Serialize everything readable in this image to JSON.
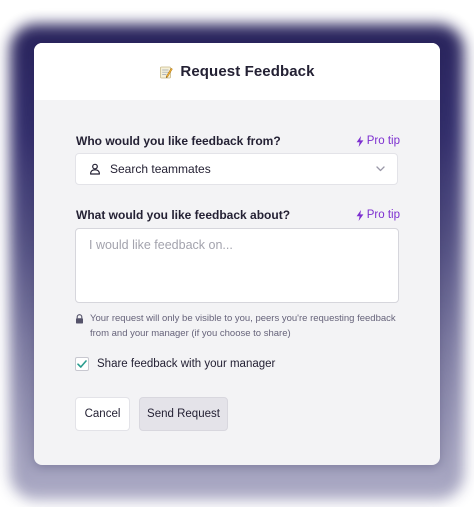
{
  "dialog": {
    "title": "Request Feedback",
    "title_icon": "memo-icon"
  },
  "recipient": {
    "label": "Who would you like feedback from?",
    "protip": "Pro tip",
    "placeholder": "Search teammates",
    "icon": "person-icon"
  },
  "topic": {
    "label": "What would you like feedback about?",
    "protip": "Pro tip",
    "placeholder": "I would like feedback on..."
  },
  "privacy": {
    "icon": "lock-icon",
    "text": "Your request will only be visible to you, peers you're requesting feedback from and your manager (if you choose to share)"
  },
  "share": {
    "label": "Share feedback with your manager",
    "checked": true
  },
  "actions": {
    "cancel_label": "Cancel",
    "send_label": "Send Request"
  },
  "colors": {
    "accent": "#7d2fd0",
    "checkmark": "#2a9d8f",
    "backdrop": "#2a2566"
  }
}
